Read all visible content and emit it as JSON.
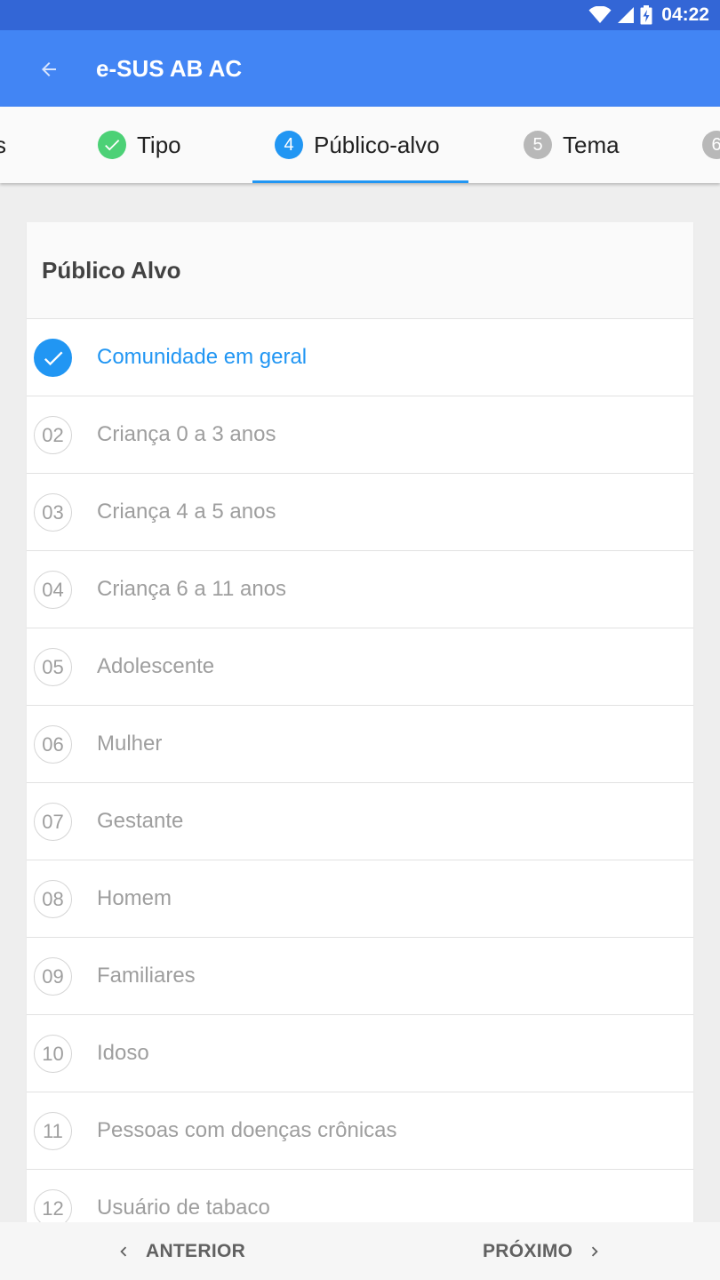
{
  "status_bar": {
    "time": "04:22",
    "icons": [
      "wifi-icon",
      "signal-icon",
      "battery-charging-icon"
    ]
  },
  "app_bar": {
    "title": "e-SUS AB AC",
    "back_icon": "arrow-back-icon"
  },
  "stepper": {
    "steps": [
      {
        "number": "",
        "label": "s",
        "state": "done"
      },
      {
        "number": "",
        "label": "Tipo",
        "state": "done"
      },
      {
        "number": "4",
        "label": "Público-alvo",
        "state": "active"
      },
      {
        "number": "5",
        "label": "Tema",
        "state": "pending"
      },
      {
        "number": "6",
        "label": "",
        "state": "pending"
      }
    ]
  },
  "colors": {
    "status_bar": "#3366d6",
    "app_bar": "#4285f4",
    "accent": "#2196f3",
    "done": "#4cd176",
    "pending": "#b8b8b8"
  },
  "card": {
    "title": "Público Alvo",
    "items": [
      {
        "number": "",
        "label": "Comunidade em geral",
        "selected": true
      },
      {
        "number": "02",
        "label": "Criança 0 a 3 anos",
        "selected": false
      },
      {
        "number": "03",
        "label": "Criança 4 a 5 anos",
        "selected": false
      },
      {
        "number": "04",
        "label": "Criança 6 a 11 anos",
        "selected": false
      },
      {
        "number": "05",
        "label": "Adolescente",
        "selected": false
      },
      {
        "number": "06",
        "label": "Mulher",
        "selected": false
      },
      {
        "number": "07",
        "label": "Gestante",
        "selected": false
      },
      {
        "number": "08",
        "label": "Homem",
        "selected": false
      },
      {
        "number": "09",
        "label": "Familiares",
        "selected": false
      },
      {
        "number": "10",
        "label": "Idoso",
        "selected": false
      },
      {
        "number": "11",
        "label": "Pessoas com doenças crônicas",
        "selected": false
      },
      {
        "number": "12",
        "label": "Usuário de tabaco",
        "selected": false
      }
    ]
  },
  "bottom_nav": {
    "prev_label": "ANTERIOR",
    "next_label": "PRÓXIMO"
  }
}
